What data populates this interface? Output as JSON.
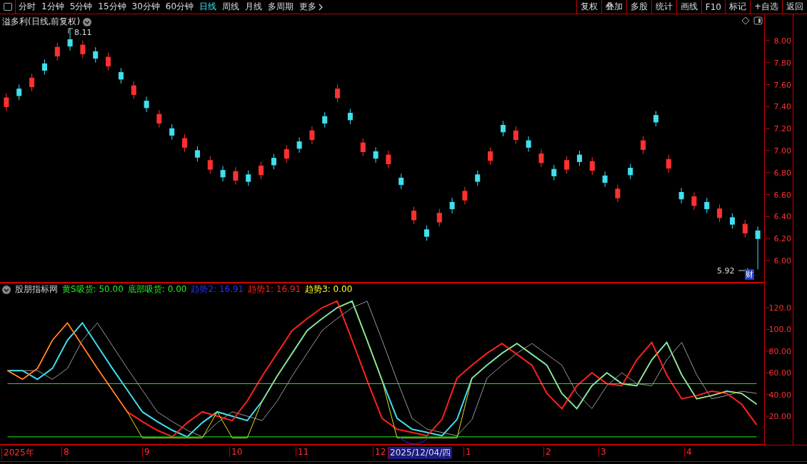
{
  "toolbar": {
    "periods": [
      {
        "label": "分时",
        "selected": false
      },
      {
        "label": "1分钟",
        "selected": false
      },
      {
        "label": "5分钟",
        "selected": false
      },
      {
        "label": "15分钟",
        "selected": false
      },
      {
        "label": "30分钟",
        "selected": false
      },
      {
        "label": "60分钟",
        "selected": false
      },
      {
        "label": "日线",
        "selected": true
      },
      {
        "label": "周线",
        "selected": false
      },
      {
        "label": "月线",
        "selected": false
      },
      {
        "label": "多周期",
        "selected": false
      },
      {
        "label": "更多",
        "selected": false
      }
    ],
    "buttons": [
      "复权",
      "叠加",
      "多股",
      "统计",
      "画线",
      "F10",
      "标记",
      "+自选",
      "返回"
    ]
  },
  "main_chart": {
    "title": "溢多利(日线,前复权)",
    "high_label": "8.11",
    "low_label": "5.92",
    "low_tag": "财",
    "chart_data": {
      "type": "candlestick",
      "ylim": [
        5.805,
        8.24
      ],
      "categories": [
        null,
        null,
        null,
        null,
        null,
        null,
        null,
        null,
        null,
        null,
        null,
        null,
        null,
        null,
        null,
        null,
        null,
        null,
        null,
        null,
        null,
        null,
        null,
        null,
        null,
        null,
        null,
        null,
        null,
        null,
        null,
        null,
        null,
        null,
        null,
        null,
        null,
        null,
        null,
        null,
        null,
        null,
        null,
        null,
        null,
        null,
        null,
        null,
        null,
        null,
        null,
        null,
        null,
        null,
        null,
        null,
        null,
        null,
        null,
        null
      ],
      "yticks": [
        {
          "value": 8,
          "label": "8.00"
        },
        {
          "value": 7.8,
          "label": "7.80"
        },
        {
          "value": 7.6,
          "label": "7.60"
        },
        {
          "value": 7.4,
          "label": "7.40"
        },
        {
          "value": 7.2,
          "label": "7.20"
        },
        {
          "value": 7,
          "label": "7.00"
        },
        {
          "value": 6.8,
          "label": "6.80"
        },
        {
          "value": 6.6,
          "label": "6.60"
        },
        {
          "value": 6.4,
          "label": "6.40"
        },
        {
          "value": 6.2,
          "label": "6.20"
        },
        {
          "value": 6,
          "label": "6.00"
        }
      ],
      "ohlc": [
        [
          7.4,
          7.52,
          7.36,
          7.48
        ],
        [
          7.56,
          7.6,
          7.46,
          7.5
        ],
        [
          7.58,
          7.7,
          7.54,
          7.66
        ],
        [
          7.79,
          7.83,
          7.69,
          7.73
        ],
        [
          7.86,
          7.98,
          7.82,
          7.94
        ],
        [
          8.01,
          8.11,
          7.91,
          7.95
        ],
        [
          7.88,
          8.0,
          7.84,
          7.96
        ],
        [
          7.9,
          7.94,
          7.8,
          7.84
        ],
        [
          7.77,
          7.89,
          7.73,
          7.85
        ],
        [
          7.71,
          7.75,
          7.61,
          7.65
        ],
        [
          7.51,
          7.63,
          7.47,
          7.59
        ],
        [
          7.45,
          7.49,
          7.35,
          7.39
        ],
        [
          7.25,
          7.37,
          7.21,
          7.33
        ],
        [
          7.2,
          7.24,
          7.1,
          7.14
        ],
        [
          7.03,
          7.15,
          6.99,
          7.11
        ],
        [
          7.0,
          7.04,
          6.9,
          6.94
        ],
        [
          6.83,
          6.95,
          6.79,
          6.91
        ],
        [
          6.82,
          6.86,
          6.72,
          6.76
        ],
        [
          6.73,
          6.85,
          6.69,
          6.81
        ],
        [
          6.78,
          6.82,
          6.68,
          6.72
        ],
        [
          6.78,
          6.9,
          6.74,
          6.86
        ],
        [
          6.93,
          6.97,
          6.83,
          6.87
        ],
        [
          6.93,
          7.05,
          6.89,
          7.01
        ],
        [
          7.08,
          7.12,
          6.98,
          7.02
        ],
        [
          7.1,
          7.22,
          7.06,
          7.18
        ],
        [
          7.31,
          7.35,
          7.21,
          7.25
        ],
        [
          7.48,
          7.6,
          7.44,
          7.56
        ],
        [
          7.34,
          7.38,
          7.24,
          7.28
        ],
        [
          6.99,
          7.11,
          6.95,
          7.07
        ],
        [
          6.99,
          7.03,
          6.89,
          6.93
        ],
        [
          6.88,
          7.0,
          6.84,
          6.96
        ],
        [
          6.75,
          6.79,
          6.65,
          6.69
        ],
        [
          6.37,
          6.49,
          6.33,
          6.45
        ],
        [
          6.28,
          6.32,
          6.18,
          6.22
        ],
        [
          6.35,
          6.47,
          6.31,
          6.43
        ],
        [
          6.53,
          6.57,
          6.43,
          6.47
        ],
        [
          6.55,
          6.67,
          6.51,
          6.63
        ],
        [
          6.78,
          6.82,
          6.68,
          6.72
        ],
        [
          6.91,
          7.03,
          6.87,
          6.99
        ],
        [
          7.23,
          7.27,
          7.13,
          7.17
        ],
        [
          7.1,
          7.22,
          7.06,
          7.18
        ],
        [
          7.09,
          7.13,
          6.99,
          7.03
        ],
        [
          6.89,
          7.01,
          6.85,
          6.97
        ],
        [
          6.83,
          6.87,
          6.73,
          6.77
        ],
        [
          6.83,
          6.95,
          6.79,
          6.91
        ],
        [
          6.96,
          7.0,
          6.86,
          6.9
        ],
        [
          6.82,
          6.94,
          6.78,
          6.9
        ],
        [
          6.77,
          6.81,
          6.67,
          6.71
        ],
        [
          6.57,
          6.69,
          6.53,
          6.65
        ],
        [
          6.84,
          6.88,
          6.74,
          6.78
        ],
        [
          7.01,
          7.13,
          6.97,
          7.09
        ],
        [
          7.32,
          7.36,
          7.22,
          7.26
        ],
        [
          6.84,
          6.96,
          6.8,
          6.92
        ],
        [
          6.62,
          6.66,
          6.52,
          6.56
        ],
        [
          6.5,
          6.62,
          6.46,
          6.58
        ],
        [
          6.53,
          6.57,
          6.43,
          6.47
        ],
        [
          6.39,
          6.51,
          6.35,
          6.47
        ],
        [
          6.39,
          6.43,
          6.29,
          6.33
        ],
        [
          6.25,
          6.37,
          6.21,
          6.33
        ],
        [
          6.27,
          6.31,
          5.92,
          6.2
        ]
      ]
    }
  },
  "indicator": {
    "name": "股朋指标网",
    "legend": [
      {
        "text": "黄S吸货: 50.00",
        "color": "#22ee22"
      },
      {
        "text": "底部吸货: 0.00",
        "color": "#22ee22"
      },
      {
        "text": "趋势2: 16.91",
        "color": "#2233ff"
      },
      {
        "text": "趋势1: 16.91",
        "color": "#ff2020"
      },
      {
        "text": "趋势3: 0.00",
        "color": "#ffff20"
      }
    ],
    "chart_data": {
      "type": "line",
      "ylim": [
        -6.3,
        143.7
      ],
      "yticks": [
        {
          "value": 120,
          "label": "120.0"
        },
        {
          "value": 100,
          "label": "100.0"
        },
        {
          "value": 80,
          "label": "80.00"
        },
        {
          "value": 60,
          "label": "60.00"
        },
        {
          "value": 40,
          "label": "40.00"
        },
        {
          "value": 20,
          "label": "20.00"
        }
      ],
      "series": [
        {
          "color": "#999999",
          "values": [
            62,
            62,
            62,
            54,
            64,
            90,
            106,
            85,
            64,
            44,
            24,
            15,
            7,
            1,
            14,
            24,
            20,
            16,
            34,
            57,
            78,
            99,
            110,
            120,
            126,
            90,
            53,
            18,
            8,
            5,
            2,
            17,
            55,
            67,
            78,
            87,
            77,
            67,
            41,
            27,
            48,
            60,
            50,
            48,
            72,
            88,
            58,
            36,
            39,
            43,
            41
          ]
        },
        {
          "color": "#40e0f0",
          "values": [
            62,
            62,
            54,
            64,
            90,
            106,
            85,
            64,
            44,
            24,
            15,
            7,
            1,
            14,
            24,
            20,
            16,
            34,
            57,
            78,
            99,
            110,
            120,
            126,
            90,
            53,
            18,
            8,
            5,
            2,
            17,
            55,
            67,
            78,
            87,
            77,
            67,
            41,
            27,
            48,
            60,
            50,
            48,
            72,
            88,
            58,
            36,
            39,
            43,
            41,
            31
          ]
        },
        {
          "color": "#ff2020",
          "values": [
            62,
            54,
            64,
            90,
            106,
            85,
            64,
            44,
            24,
            15,
            7,
            1,
            14,
            24,
            20,
            16,
            34,
            57,
            78,
            99,
            110,
            120,
            126,
            90,
            53,
            18,
            8,
            5,
            2,
            17,
            55,
            67,
            78,
            87,
            77,
            67,
            41,
            27,
            48,
            60,
            50,
            48,
            72,
            88,
            58,
            36,
            39,
            43,
            41,
            31,
            12
          ]
        },
        {
          "color": "#22ee22",
          "values": [
            50,
            50,
            50,
            50,
            50,
            50,
            50,
            50,
            50,
            50,
            50,
            50,
            50,
            50,
            50,
            50,
            50,
            50,
            50,
            50,
            50,
            50,
            50,
            50,
            50,
            50,
            50,
            50,
            50,
            50,
            50,
            50,
            50,
            50,
            50,
            50,
            50,
            50,
            50,
            50,
            50,
            50,
            50,
            50,
            50,
            50,
            50,
            50,
            50,
            50,
            50
          ]
        },
        {
          "color": "#22ee22",
          "values": [
            1,
            1,
            1,
            1,
            1,
            1,
            1,
            1,
            1,
            1,
            1,
            1,
            1,
            1,
            1,
            1,
            1,
            1,
            1,
            1,
            1,
            1,
            1,
            1,
            1,
            1,
            1,
            1,
            1,
            1,
            1,
            1,
            1,
            1,
            1,
            1,
            1,
            1,
            1,
            1,
            1,
            1,
            1,
            1,
            1,
            1,
            1,
            1,
            1,
            1,
            1
          ]
        },
        {
          "color": "#e8e020",
          "values": [
            62,
            54,
            64,
            90,
            106,
            85,
            64,
            44,
            24,
            0,
            0,
            0,
            0,
            0,
            24,
            0,
            0,
            34,
            57,
            78,
            99,
            110,
            120,
            126,
            90,
            53,
            0,
            0,
            0,
            0,
            0,
            55,
            67,
            78,
            87,
            77,
            67,
            41,
            27,
            48,
            60,
            50,
            48,
            72,
            88,
            58,
            36,
            39,
            43,
            41,
            31
          ]
        }
      ]
    }
  },
  "timeline": [
    {
      "label": "2025年",
      "selected": false
    },
    {
      "label": "8",
      "selected": false
    },
    {
      "label": "9",
      "selected": false
    },
    {
      "label": "10",
      "selected": false
    },
    {
      "label": "11",
      "selected": false
    },
    {
      "label": "12",
      "selected": false
    },
    {
      "label": "2025/12/04/四",
      "selected": true
    },
    {
      "label": "1",
      "selected": false
    },
    {
      "label": "2",
      "selected": false
    },
    {
      "label": "3",
      "selected": false
    },
    {
      "label": "4",
      "selected": false
    }
  ]
}
